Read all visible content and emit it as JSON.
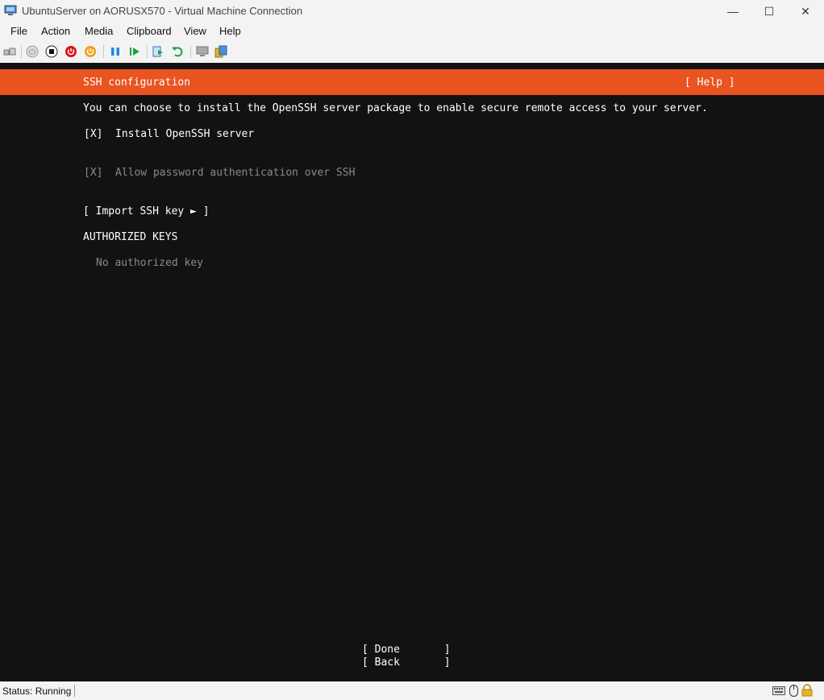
{
  "window": {
    "title": "UbuntuServer on AORUSX570 - Virtual Machine Connection",
    "minimize": "—",
    "maximize": "☐",
    "close": "✕"
  },
  "menu": [
    "File",
    "Action",
    "Media",
    "Clipboard",
    "View",
    "Help"
  ],
  "toolbar": {
    "icons": [
      "ctrl-alt-del-icon",
      "start-icon",
      "turn-off-icon",
      "shut-down-icon",
      "save-icon",
      "pause-icon",
      "resume-icon",
      "checkpoint-icon",
      "revert-icon",
      "enhanced-session-icon",
      "share-icon"
    ]
  },
  "installer": {
    "header": "SSH configuration",
    "help": "[ Help ]",
    "description": "You can choose to install the OpenSSH server package to enable secure remote access to your server.",
    "install_checkbox": "[X]",
    "install_label": "Install OpenSSH server",
    "password_checkbox": "[X]",
    "password_label": "Allow password authentication over SSH",
    "import_button": "[ Import SSH key ► ]",
    "authorized_heading": "AUTHORIZED KEYS",
    "no_key": "No authorized key",
    "done_button": "[ Done       ]",
    "back_button": "[ Back       ]"
  },
  "status": {
    "text": "Status: Running"
  },
  "colors": {
    "accent": "#e95420",
    "background": "#121212"
  }
}
